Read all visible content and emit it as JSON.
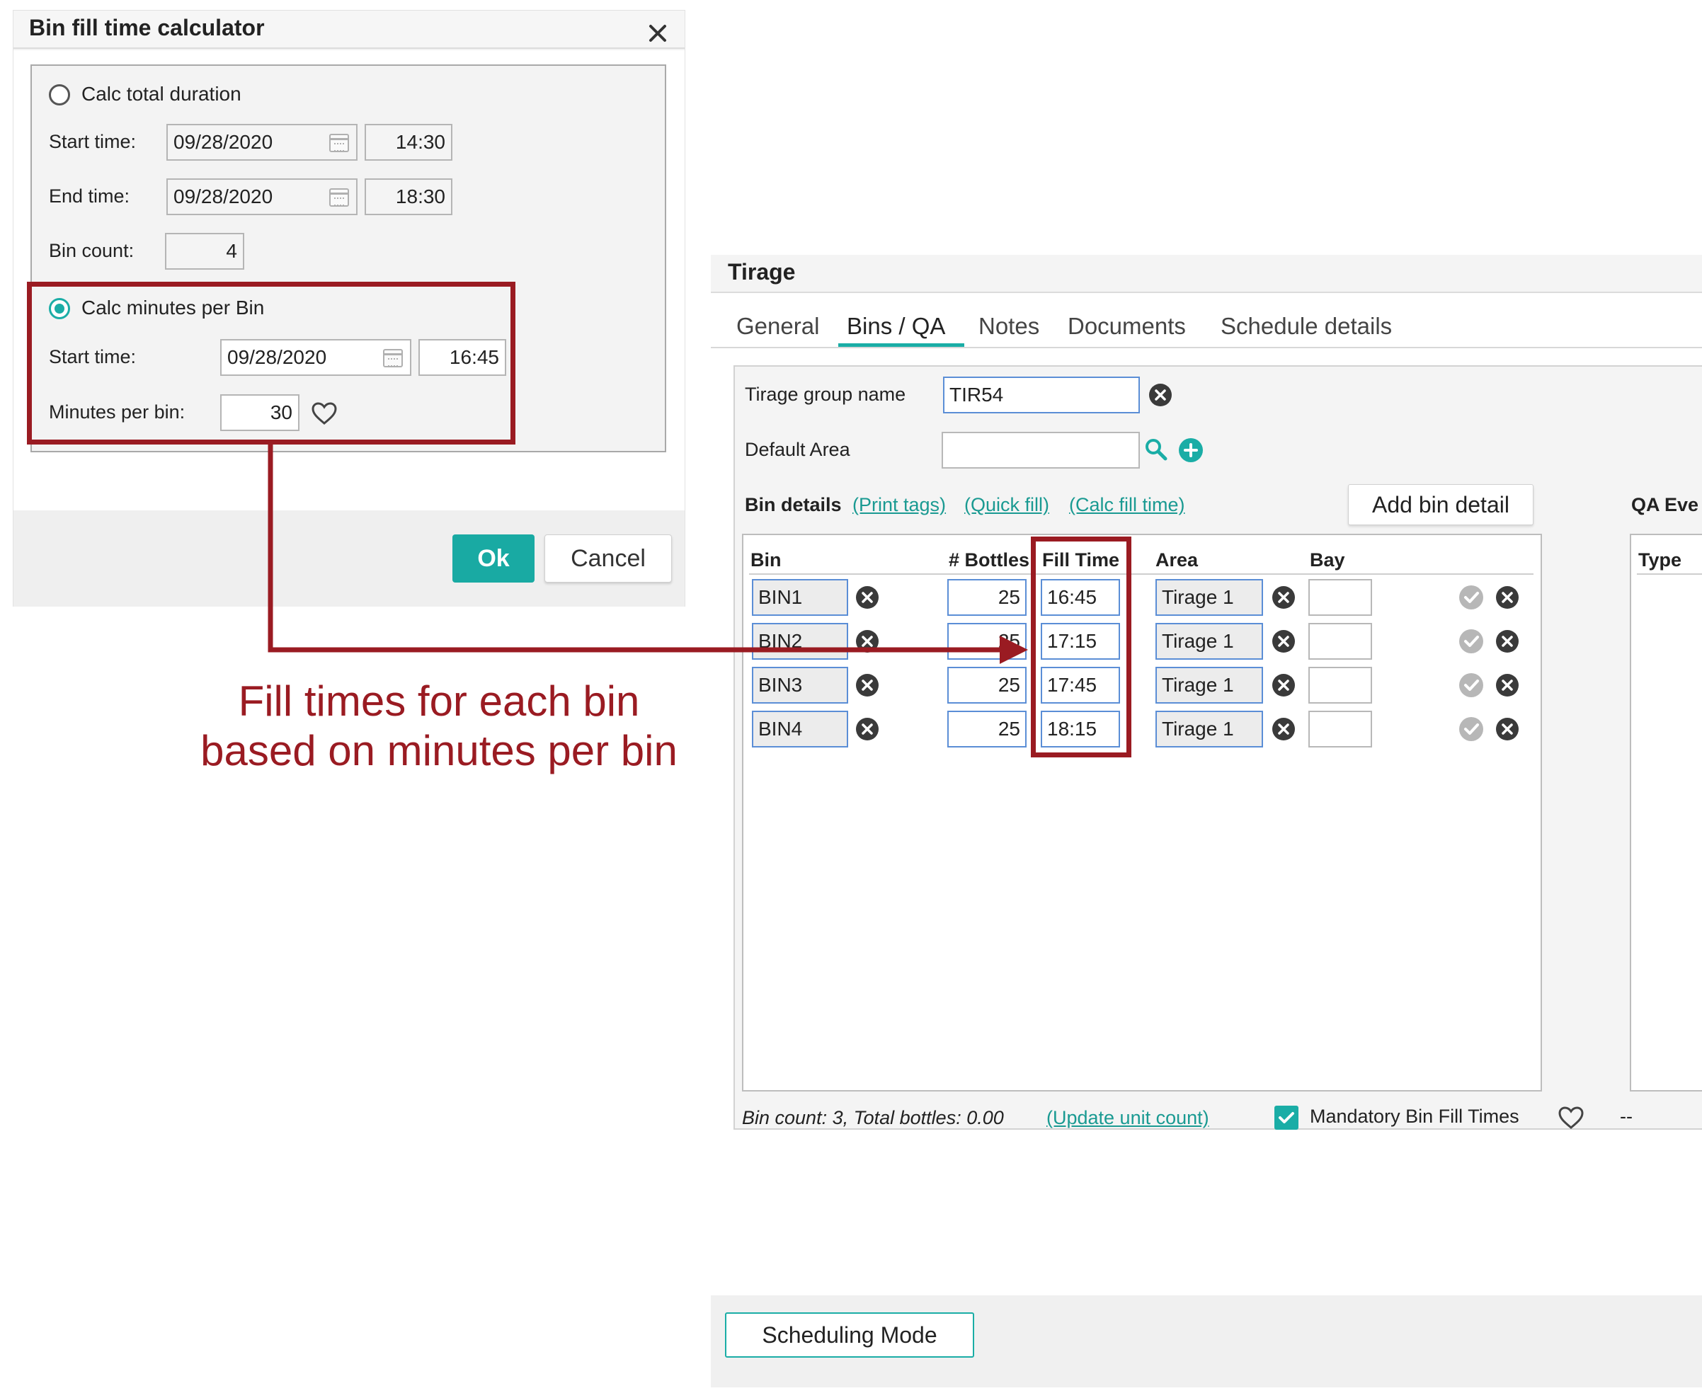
{
  "dialog": {
    "title": "Bin fill time calculator",
    "close_icon": "close-icon",
    "calc_total": {
      "label": "Calc total duration",
      "start_label": "Start time:",
      "start_date": "09/28/2020",
      "start_time": "14:30",
      "end_label": "End time:",
      "end_date": "09/28/2020",
      "end_time": "18:30",
      "bin_count_label": "Bin count:",
      "bin_count": "4"
    },
    "calc_minutes": {
      "label": "Calc minutes per Bin",
      "start_label": "Start time:",
      "start_date": "09/28/2020",
      "start_time": "16:45",
      "minutes_label": "Minutes per bin:",
      "minutes": "30"
    },
    "ok_label": "Ok",
    "cancel_label": "Cancel"
  },
  "tirage": {
    "title": "Tirage",
    "tabs": [
      "General",
      "Bins / QA",
      "Notes",
      "Documents",
      "Schedule details"
    ],
    "active_tab": "Bins / QA",
    "group_name_label": "Tirage group name",
    "group_name": "TIR54",
    "default_area_label": "Default Area",
    "default_area": "",
    "bin_details_label": "Bin details",
    "links": [
      "(Print tags)",
      "(Quick fill)",
      "(Calc fill time)"
    ],
    "add_bin_label": "Add bin detail",
    "qa_label": "QA Eve",
    "qa_type_label": "Type",
    "columns": [
      "Bin",
      "# Bottles",
      "Fill Time",
      "Area",
      "Bay"
    ],
    "bins": [
      {
        "bin": "BIN1",
        "bottles": "25",
        "fill_time": "16:45",
        "area": "Tirage 1",
        "bay": ""
      },
      {
        "bin": "BIN2",
        "bottles": "25",
        "fill_time": "17:15",
        "area": "Tirage 1",
        "bay": ""
      },
      {
        "bin": "BIN3",
        "bottles": "25",
        "fill_time": "17:45",
        "area": "Tirage 1",
        "bay": ""
      },
      {
        "bin": "BIN4",
        "bottles": "25",
        "fill_time": "18:15",
        "area": "Tirage 1",
        "bay": ""
      }
    ],
    "summary": "Bin count: 3, Total bottles: 0.00",
    "update_link": "(Update unit count)",
    "mandatory_label": "Mandatory Bin Fill Times",
    "mandatory_checked": true,
    "dash": "--",
    "scheduling_label": "Scheduling Mode"
  },
  "annotation": {
    "line1": "Fill times for each bin",
    "line2": "based on minutes per bin",
    "color": "#9a1b22"
  },
  "colors": {
    "accent": "#1aada6",
    "annotation": "#9a1b22",
    "input_border": "#5b8ed6"
  }
}
